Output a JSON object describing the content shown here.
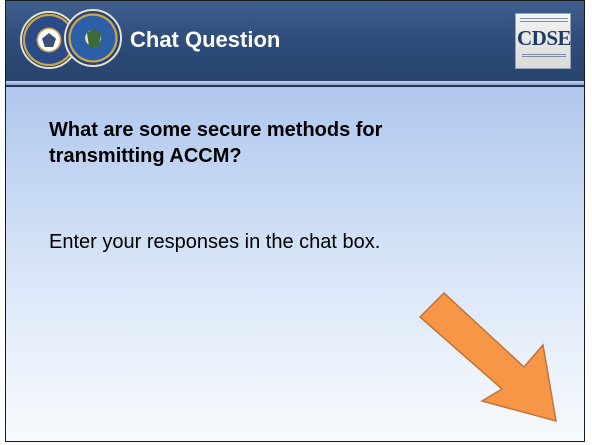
{
  "header": {
    "title": "Chat Question",
    "logo_text": "CDSE",
    "seals": [
      "dod-seal-icon",
      "dss-seal-icon"
    ]
  },
  "content": {
    "question": "What are some secure methods for transmitting ACCM?",
    "instruction": "Enter your responses in the chat box."
  },
  "colors": {
    "header_bg": "#2f4e7c",
    "arrow_fill": "#f79646",
    "arrow_stroke": "#c0733a",
    "body_gradient_top": "#9cb9e8",
    "body_gradient_bottom": "#f7fafd"
  },
  "decorations": {
    "arrow": "arrow-pointing-to-chat-box-icon"
  }
}
